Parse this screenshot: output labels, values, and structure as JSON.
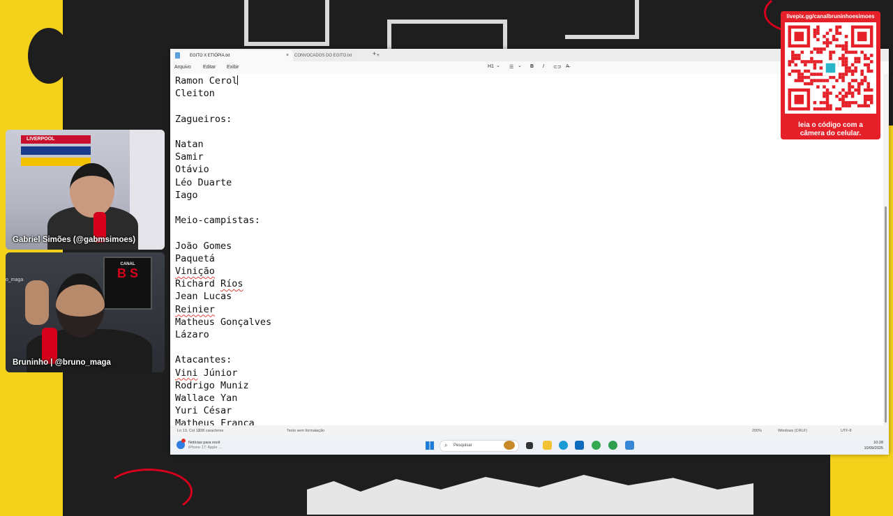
{
  "stream": {
    "qr_url": "livepix.gg/canalbruninhoesimoes",
    "qr_caption_line1": "leia o código com a",
    "qr_caption_line2": "câmera do celular.",
    "cam1_name": "Gabriel Simões (@gabmsimoes)",
    "cam2_name": "Bruninho | @bruno_maga",
    "cam2_overlay_text": "o_maga",
    "cam1_scarf1": "LIVERPOOL",
    "canal_logo_top": "CANAL",
    "canal_logo_main": "B S"
  },
  "notepad": {
    "tabs": [
      {
        "label": "EGITO X ETIÓPIA.txt",
        "active": true
      },
      {
        "label": "CONVOCADOS DO EGITO.txt",
        "active": false
      }
    ],
    "new_tab": "+",
    "close_glyph": "×",
    "menu": [
      "Arquivo",
      "Editar",
      "Exibir"
    ],
    "toolbar": {
      "heading": "H1",
      "heading_chevron": "⌄",
      "list": "☰",
      "list_chevron": "⌄",
      "bold": "B",
      "italic": "I",
      "link": "⊂⊃",
      "clear": "A̶"
    },
    "lines": [
      {
        "text": "Ramon Cerol",
        "spell": false,
        "caret": true
      },
      {
        "text": "Cleiton",
        "spell": false
      },
      {
        "text": "",
        "spell": false
      },
      {
        "text": "Zagueiros:",
        "spell": false
      },
      {
        "text": "",
        "spell": false
      },
      {
        "text": "Natan",
        "spell": false
      },
      {
        "text": "Samir",
        "spell": false
      },
      {
        "text": "Otávio",
        "spell": false
      },
      {
        "text": "Léo Duarte",
        "spell": false
      },
      {
        "text": "Iago",
        "spell": false
      },
      {
        "text": "",
        "spell": false
      },
      {
        "text": "Meio-campistas:",
        "spell": false
      },
      {
        "text": "",
        "spell": false
      },
      {
        "text": "João Gomes",
        "spell": false
      },
      {
        "text": "Paquetá",
        "spell": false
      },
      {
        "text": "Vinição",
        "spell": true
      },
      {
        "text": "Richard Ríos",
        "spell": false,
        "spell_word": "Ríos",
        "prefix": "Richard "
      },
      {
        "text": "Jean Lucas",
        "spell": false
      },
      {
        "text": "Reinier",
        "spell": true
      },
      {
        "text": "Matheus Gonçalves",
        "spell": false
      },
      {
        "text": "Lázaro",
        "spell": false
      },
      {
        "text": "",
        "spell": false
      },
      {
        "text": "Atacantes:",
        "spell": false
      },
      {
        "text": "Vini Júnior",
        "spell": false,
        "spell_word": "Vini",
        "suffix": " Júnior"
      },
      {
        "text": "Rodrigo Muniz",
        "spell": false
      },
      {
        "text": "Wallace Yan",
        "spell": false
      },
      {
        "text": "Yuri César",
        "spell": false
      },
      {
        "text": "Matheus França",
        "spell": false
      }
    ],
    "status": {
      "position": "Ln 13, Col 12",
      "chars": "338 caracteres",
      "format": "Texto sem formatação",
      "zoom": "200%",
      "line_ending": "Windows (CRLF)",
      "encoding": "UTF-8"
    }
  },
  "taskbar": {
    "news_line1": "Notícias para você",
    "news_line2": "iPhone 17: Apple ...",
    "search_placeholder": "Pesquisar",
    "search_icon": "⌕",
    "time": "10:28",
    "date": "10/09/2025"
  },
  "colors": {
    "stream_yellow": "#f4d21b",
    "stream_red": "#e52028",
    "spell_underline": "#e0403a"
  }
}
